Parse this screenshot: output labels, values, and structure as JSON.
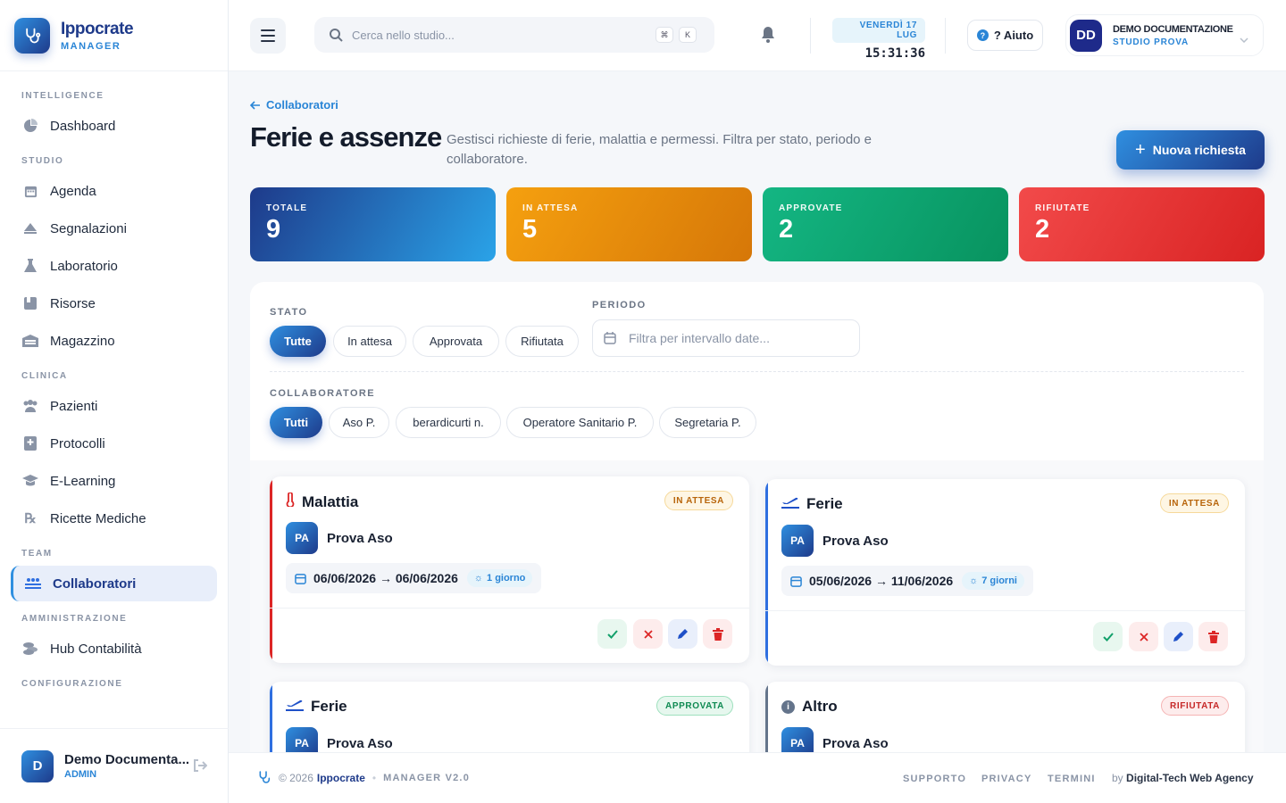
{
  "brand": {
    "name": "Ippocrate",
    "sub": "MANAGER"
  },
  "sidebar": {
    "sections": [
      {
        "title": "INTELLIGENCE",
        "items": [
          "Dashboard"
        ]
      },
      {
        "title": "STUDIO",
        "items": [
          "Agenda",
          "Segnalazioni",
          "Laboratorio",
          "Risorse",
          "Magazzino"
        ]
      },
      {
        "title": "CLINICA",
        "items": [
          "Pazienti",
          "Protocolli",
          "E-Learning",
          "Ricette Mediche"
        ]
      },
      {
        "title": "TEAM",
        "items": [
          "Collaboratori"
        ]
      },
      {
        "title": "AMMINISTRAZIONE",
        "items": [
          "Hub Contabilità"
        ]
      },
      {
        "title": "CONFIGURAZIONE",
        "items": []
      }
    ],
    "active": "Collaboratori",
    "user": {
      "initial": "D",
      "name": "Demo Documenta...",
      "role": "ADMIN"
    }
  },
  "topbar": {
    "search_placeholder": "Cerca nello studio...",
    "kbd1": "⌘",
    "kbd2": "K",
    "date": "VENERDÌ 17 LUG",
    "time": "15:31:36",
    "help": "? Aiuto",
    "account": {
      "initials": "DD",
      "name": "DEMO DOCUMENTAZIONE",
      "sub": "STUDIO PROVA"
    }
  },
  "page": {
    "breadcrumb": "Collaboratori",
    "title": "Ferie e assenze",
    "subtitle": "Gestisci richieste di ferie, malattia e permessi. Filtra per stato, periodo e collaboratore.",
    "new_button": "Nuova richiesta"
  },
  "stats": [
    {
      "label": "TOTALE",
      "value": "9",
      "color": "#1e3a8a"
    },
    {
      "label": "IN ATTESA",
      "value": "5",
      "color": "#f29a0e"
    },
    {
      "label": "APPROVATE",
      "value": "2",
      "color": "#12b07a"
    },
    {
      "label": "RIFIUTATE",
      "value": "2",
      "color": "#ef3b3b"
    }
  ],
  "filters": {
    "stato_label": "STATO",
    "stato_options": [
      "Tutte",
      "In attesa",
      "Approvata",
      "Rifiutata"
    ],
    "stato_selected": "Tutte",
    "periodo_label": "PERIODO",
    "periodo_placeholder": "Filtra per intervallo date...",
    "collab_label": "COLLABORATORE",
    "collab_options": [
      "Tutti",
      "Aso P.",
      "berardicurti n.",
      "Operatore Sanitario P.",
      "Segretaria P."
    ],
    "collab_selected": "Tutti"
  },
  "requests": [
    {
      "type": "Malattia",
      "status": "IN ATTESA",
      "initials": "PA",
      "person": "Prova Aso",
      "range": "06/06/2026 → 06/06/2026",
      "days": "1 giorno",
      "accent": "#dc2626"
    },
    {
      "type": "Ferie",
      "status": "IN ATTESA",
      "initials": "PA",
      "person": "Prova Aso",
      "range": "05/06/2026 → 11/06/2026",
      "days": "7 giorni",
      "accent": "#2f6fe0"
    },
    {
      "type": "Ferie",
      "status": "APPROVATA",
      "initials": "PA",
      "person": "Prova Aso",
      "accent": "#2f6fe0"
    },
    {
      "type": "Altro",
      "status": "RIFIUTATA",
      "initials": "PA",
      "person": "Prova Aso",
      "accent": "#64748b"
    }
  ],
  "footer": {
    "copyright": "© 2026",
    "brand": "Ippocrate",
    "version": "MANAGER V2.0",
    "links": [
      "SUPPORTO",
      "PRIVACY",
      "TERMINI"
    ],
    "by_prefix": "by",
    "by": "Digital-Tech Web Agency"
  }
}
